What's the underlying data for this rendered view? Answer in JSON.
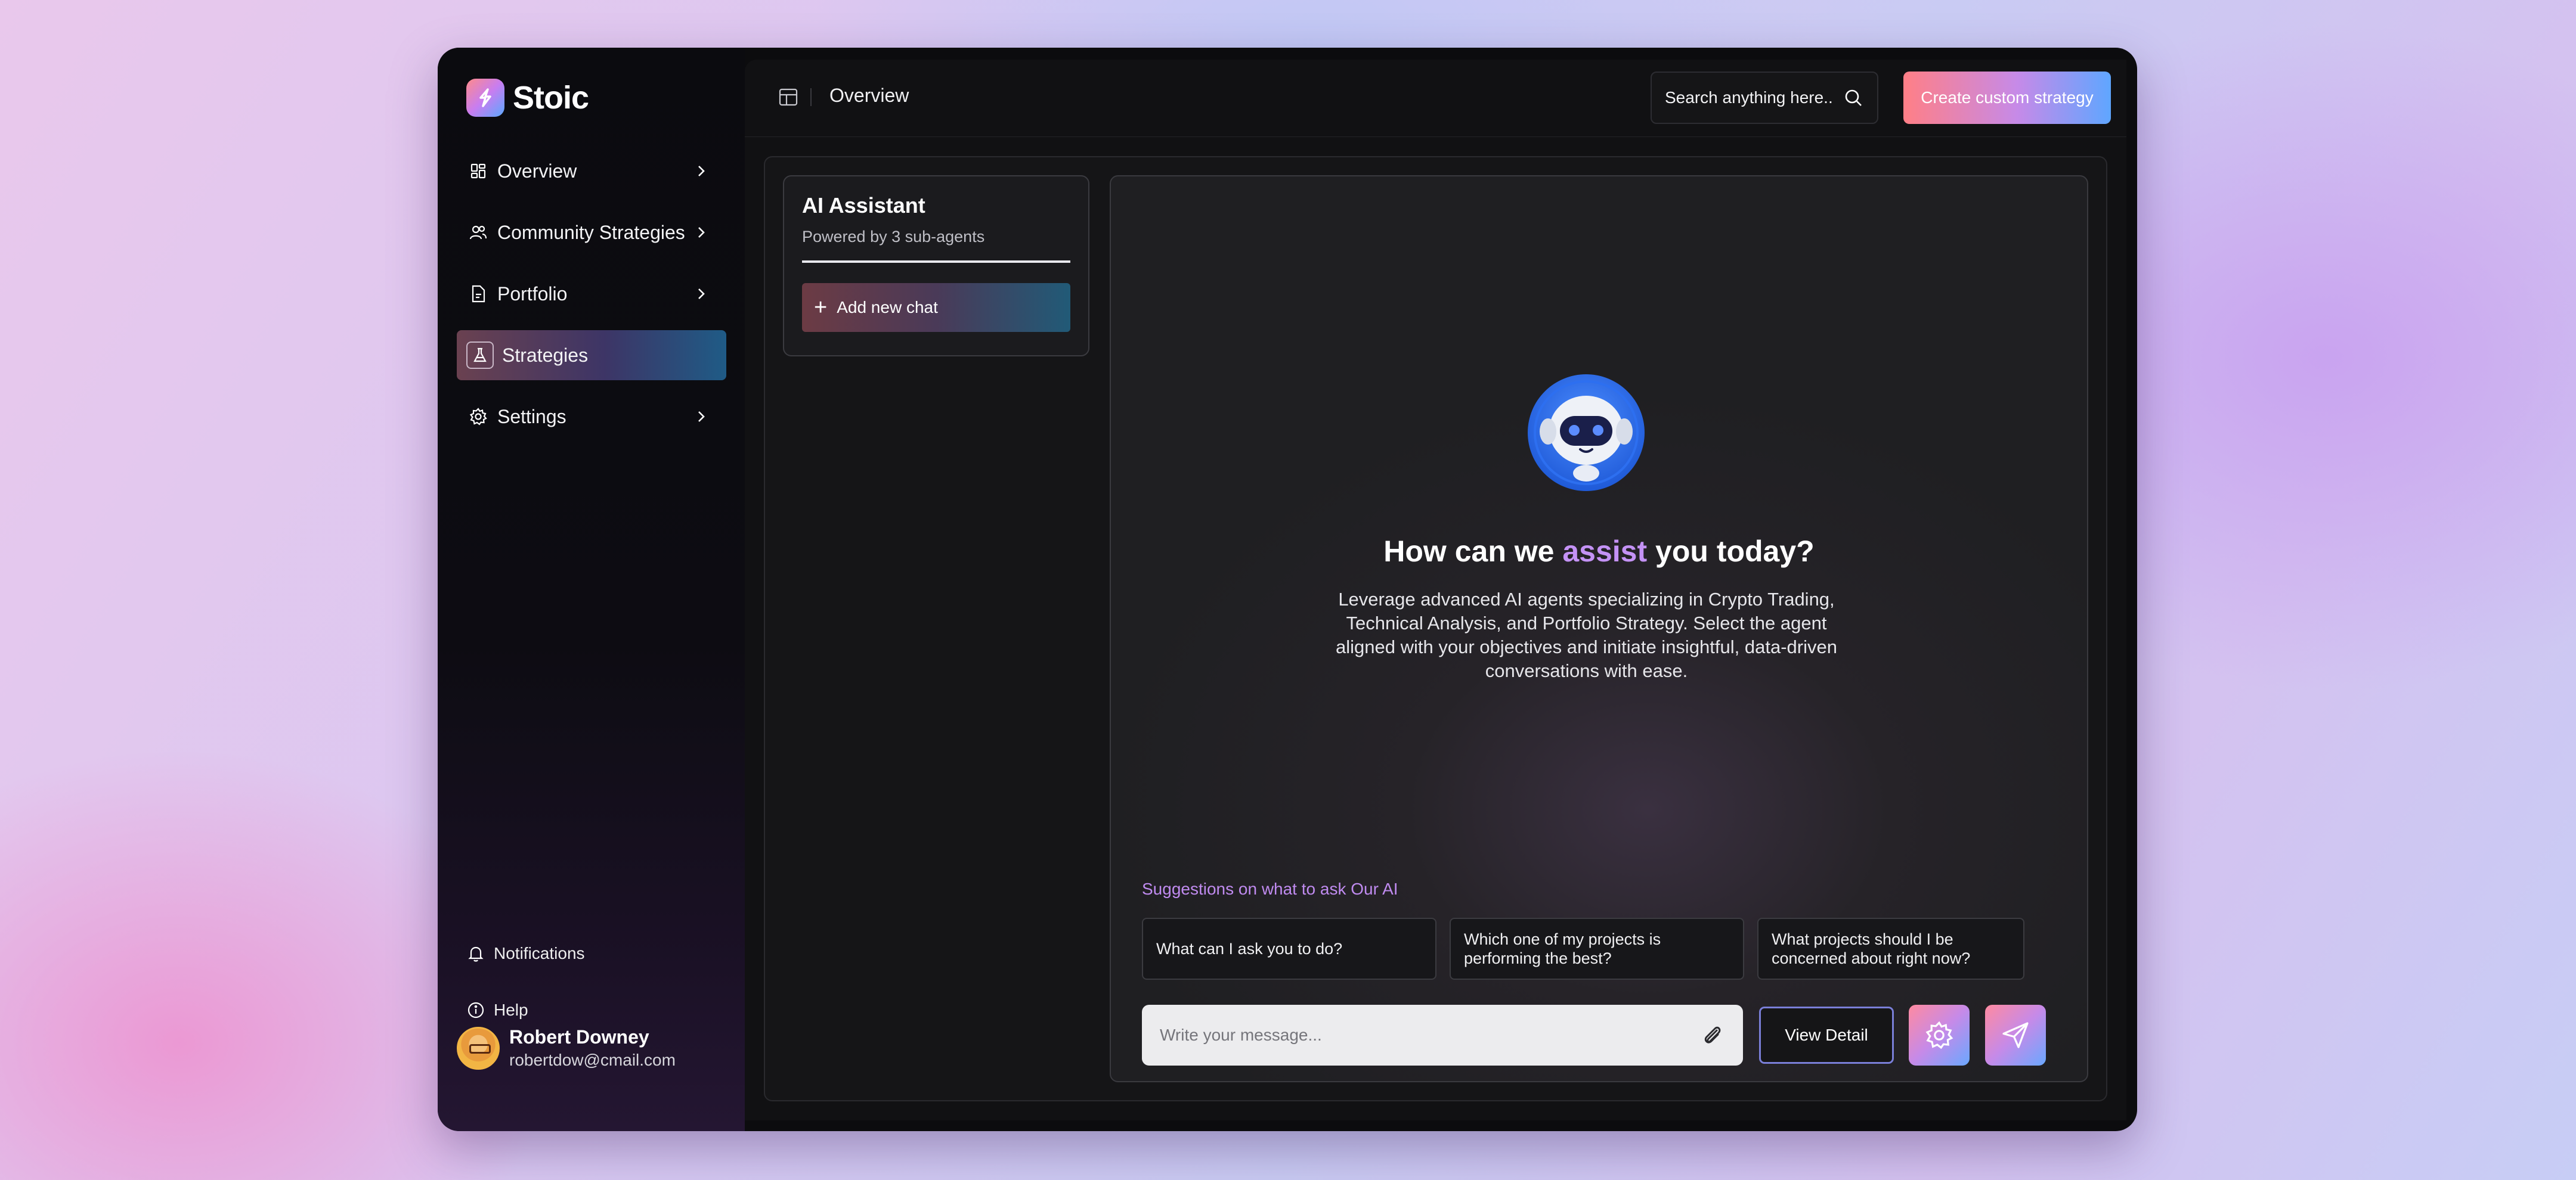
{
  "brand": {
    "name": "Stoic"
  },
  "sidebar": {
    "items": [
      {
        "label": "Overview",
        "icon": "grid-icon"
      },
      {
        "label": "Community Strategies",
        "icon": "users-icon"
      },
      {
        "label": "Portfolio",
        "icon": "document-icon"
      },
      {
        "label": "Strategies",
        "icon": "flask-icon",
        "active": true
      },
      {
        "label": "Settings",
        "icon": "gear-icon"
      }
    ],
    "bottom": [
      {
        "label": "Notifications",
        "icon": "bell-icon"
      },
      {
        "label": "Help",
        "icon": "info-icon"
      }
    ],
    "user": {
      "name": "Robert Downey",
      "email": "robertdow@cmail.com"
    }
  },
  "header": {
    "title": "Overview",
    "search_placeholder": "Search anything here..",
    "cta_label": "Create custom strategy"
  },
  "assistant_card": {
    "title": "AI Assistant",
    "subtitle": "Powered by 3 sub-agents",
    "add_chat_label": "Add new chat"
  },
  "chat": {
    "headline_before": "How can we ",
    "headline_accent": "assist",
    "headline_after": " you today?",
    "description": "Leverage advanced AI agents specializing in Crypto Trading, Technical Analysis, and Portfolio Strategy. Select the agent aligned with your objectives and initiate insightful, data-driven conversations with ease.",
    "suggestions_label": "Suggestions on what to ask Our AI",
    "suggestions": [
      "What can I ask you to do?",
      "Which one of my projects is performing the best?",
      "What projects should I be concerned about right now?"
    ],
    "input_placeholder": "Write your message...",
    "view_detail_label": "View Detail"
  },
  "colors": {
    "accent_purple": "#c492f5",
    "gradient_start": "#ff7f86",
    "gradient_end": "#5fa6ff"
  }
}
